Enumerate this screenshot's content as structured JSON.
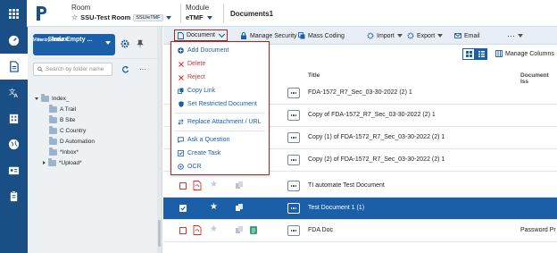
{
  "header": {
    "room_label": "Room",
    "room_name": "SSU-Test Room",
    "room_tag": "SSU/eTMF",
    "module_label": "Module",
    "module_name": "eTMF",
    "breadcrumb": "Documents1"
  },
  "sidebar": {
    "viewby_label": "View by",
    "viewby_value": "Index",
    "filters_label": "Filters",
    "filters_value": "Show Empty ...",
    "search_placeholder": "Search by folder name",
    "tree": [
      {
        "label": "Index_",
        "level": 0,
        "expanded": true
      },
      {
        "label": "A Trail",
        "level": 1
      },
      {
        "label": "B Site",
        "level": 1
      },
      {
        "label": "C Country",
        "level": 1
      },
      {
        "label": "D Automation",
        "level": 1
      },
      {
        "label": "*Inbox*",
        "level": 1
      },
      {
        "label": "*Upload*",
        "level": 1,
        "collapsed": true
      }
    ]
  },
  "toolbar": {
    "document": "Document",
    "manage_security": "Manage Security",
    "mass_coding": "Mass Coding",
    "import": "Import",
    "export": "Export",
    "email": "Email",
    "more": "···",
    "manage_columns": "Manage Columns"
  },
  "columns": {
    "title": "Title",
    "document_issue": "Document Iss"
  },
  "dropdown": {
    "items": [
      {
        "label": "Add Document",
        "icon": "plus-circle-icon",
        "style": "normal"
      },
      {
        "label": "Delete",
        "icon": "x-icon",
        "style": "danger"
      },
      {
        "label": "Reject",
        "icon": "x-icon",
        "style": "danger"
      },
      {
        "label": "Copy Link",
        "icon": "copy-icon",
        "style": "normal"
      },
      {
        "label": "Set Restricted Document",
        "icon": "shield-icon",
        "style": "normal"
      },
      {
        "label": "Replace Attachment / URL",
        "icon": "swap-icon",
        "style": "normal"
      },
      {
        "label": "Ask a Question",
        "icon": "chat-icon",
        "style": "normal"
      },
      {
        "label": "Create Task",
        "icon": "task-icon",
        "style": "normal"
      },
      {
        "label": "OCR",
        "icon": "ocr-icon",
        "style": "normal"
      }
    ]
  },
  "rows": [
    {
      "title": "FDA-1572_R7_Sec_03-30-2022 (2) 1",
      "selected": false,
      "extra": ""
    },
    {
      "title": "Copy of FDA-1572_R7_Sec_03-30-2022 (2) 1",
      "selected": false,
      "extra": ""
    },
    {
      "title": "Copy (1) of FDA-1572_R7_Sec_03-30-2022 (2) 1",
      "selected": false,
      "extra": ""
    },
    {
      "title": "Copy (2) of FDA-1572_R7_Sec_03-30-2022 (2) 1",
      "selected": false,
      "extra": ""
    },
    {
      "title": "TI automate Test Document",
      "selected": false,
      "extra": ""
    },
    {
      "title": "Test Document 1 (1)",
      "selected": true,
      "extra": ""
    },
    {
      "title": "FDA Doc",
      "selected": false,
      "extra": "Password Pr"
    }
  ],
  "colors": {
    "primary": "#1a4f86",
    "accent": "#1a5fa8",
    "danger": "#d0312d",
    "highlight_border": "#a52a2a"
  }
}
